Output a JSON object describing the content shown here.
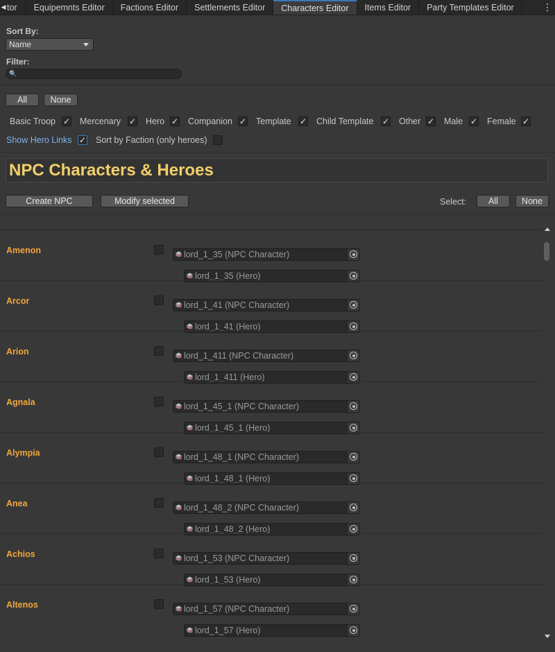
{
  "tabs": [
    {
      "label": "tor"
    },
    {
      "label": "Equipemnts Editor"
    },
    {
      "label": "Factions Editor"
    },
    {
      "label": "Settlements Editor"
    },
    {
      "label": "Characters Editor"
    },
    {
      "label": "Items Editor"
    },
    {
      "label": "Party Templates Editor"
    }
  ],
  "active_tab": "Characters Editor",
  "sort": {
    "label": "Sort By:",
    "value": "Name"
  },
  "filter": {
    "label": "Filter:",
    "value": ""
  },
  "quick_select": {
    "all": "All",
    "none": "None"
  },
  "filters": [
    {
      "label": "Basic Troop",
      "checked": true
    },
    {
      "label": "Mercenary",
      "checked": true
    },
    {
      "label": "Hero",
      "checked": true
    },
    {
      "label": "Companion",
      "checked": true
    },
    {
      "label": "Template",
      "checked": true
    },
    {
      "label": "Child Template",
      "checked": true
    },
    {
      "label": "Other",
      "checked": true
    },
    {
      "label": "Male",
      "checked": true
    },
    {
      "label": "Female",
      "checked": true
    }
  ],
  "options": {
    "show_hero_links": "Show Hero Links",
    "show_hero_links_checked": true,
    "sort_by_faction": "Sort by Faction (only heroes)",
    "sort_by_faction_checked": false
  },
  "section_title": "NPC Characters & Heroes",
  "actions": {
    "create": "Create NPC",
    "modify": "Modify selected"
  },
  "select": {
    "label": "Select:",
    "all": "All",
    "none": "None"
  },
  "characters": [
    {
      "name": "Amenon",
      "npc": "lord_1_35 (NPC Character)",
      "hero": "lord_1_35 (Hero)"
    },
    {
      "name": "Arcor",
      "npc": "lord_1_41 (NPC Character)",
      "hero": "lord_1_41 (Hero)"
    },
    {
      "name": "Arion",
      "npc": "lord_1_411 (NPC Character)",
      "hero": "lord_1_411 (Hero)"
    },
    {
      "name": "Agnala",
      "npc": "lord_1_45_1 (NPC Character)",
      "hero": "lord_1_45_1 (Hero)"
    },
    {
      "name": "Alympia",
      "npc": "lord_1_48_1 (NPC Character)",
      "hero": "lord_1_48_1 (Hero)"
    },
    {
      "name": "Anea",
      "npc": "lord_1_48_2 (NPC Character)",
      "hero": "lord_1_48_2 (Hero)"
    },
    {
      "name": "Achios",
      "npc": "lord_1_53 (NPC Character)",
      "hero": "lord_1_53 (Hero)"
    },
    {
      "name": "Altenos",
      "npc": "lord_1_57 (NPC Character)",
      "hero": "lord_1_57 (Hero)"
    }
  ],
  "colors": {
    "name": "#f0a63c",
    "title": "#f2cf69",
    "link": "#80b2ec",
    "accent": "#3a79bb"
  }
}
